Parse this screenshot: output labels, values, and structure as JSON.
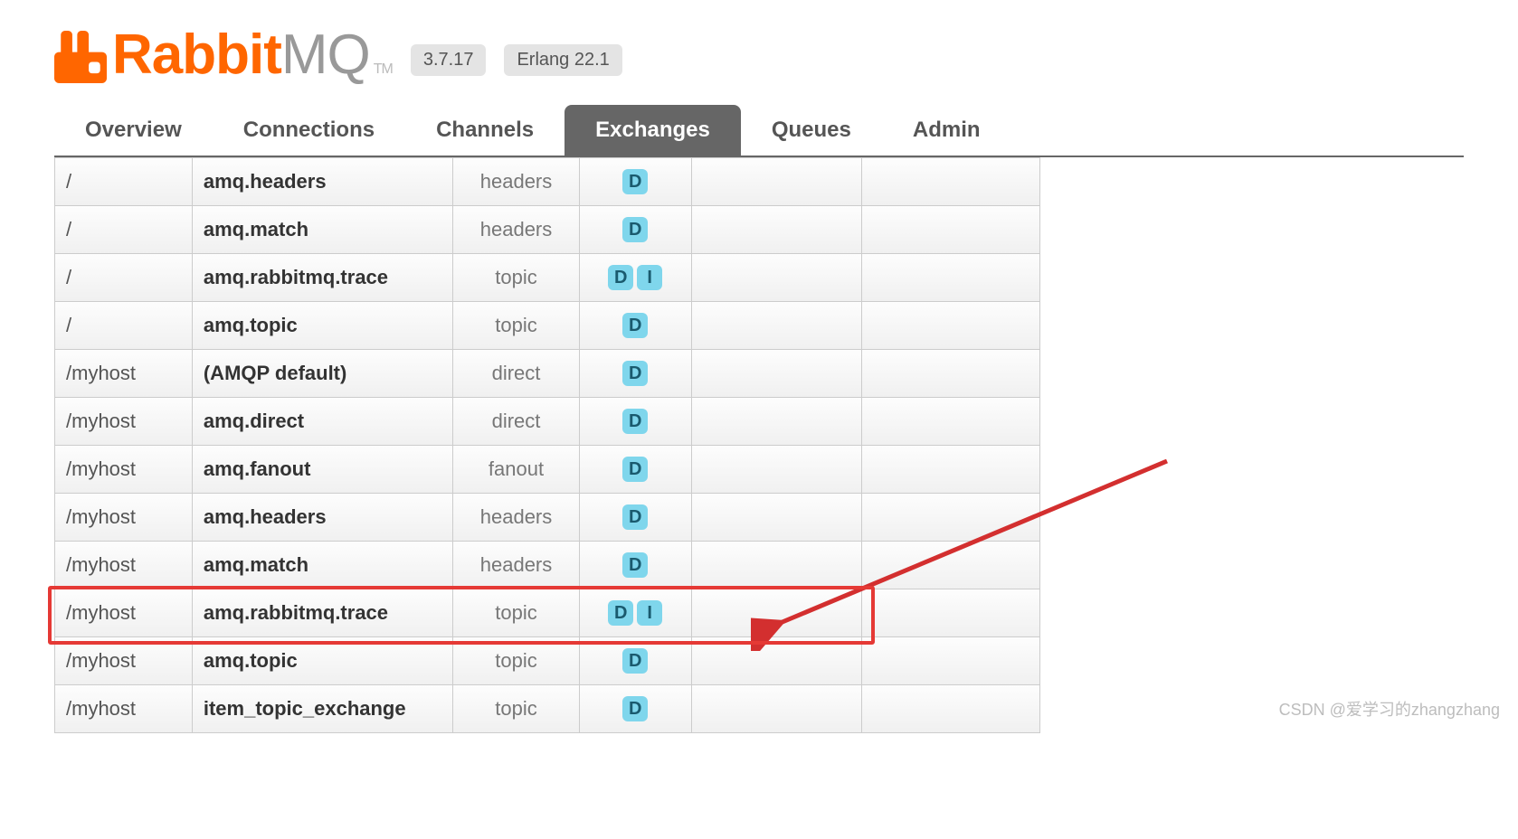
{
  "header": {
    "product_primary": "Rabbit",
    "product_secondary": "MQ",
    "trademark": "TM",
    "version_badge": "3.7.17",
    "erlang_badge": "Erlang 22.1"
  },
  "tabs": [
    {
      "id": "overview",
      "label": "Overview",
      "active": false
    },
    {
      "id": "connections",
      "label": "Connections",
      "active": false
    },
    {
      "id": "channels",
      "label": "Channels",
      "active": false
    },
    {
      "id": "exchanges",
      "label": "Exchanges",
      "active": true
    },
    {
      "id": "queues",
      "label": "Queues",
      "active": false
    },
    {
      "id": "admin",
      "label": "Admin",
      "active": false
    }
  ],
  "exchanges": [
    {
      "vhost": "/",
      "name": "amq.headers",
      "type": "headers",
      "flags": [
        "D"
      ]
    },
    {
      "vhost": "/",
      "name": "amq.match",
      "type": "headers",
      "flags": [
        "D"
      ]
    },
    {
      "vhost": "/",
      "name": "amq.rabbitmq.trace",
      "type": "topic",
      "flags": [
        "D",
        "I"
      ]
    },
    {
      "vhost": "/",
      "name": "amq.topic",
      "type": "topic",
      "flags": [
        "D"
      ]
    },
    {
      "vhost": "/myhost",
      "name": "(AMQP default)",
      "type": "direct",
      "flags": [
        "D"
      ]
    },
    {
      "vhost": "/myhost",
      "name": "amq.direct",
      "type": "direct",
      "flags": [
        "D"
      ]
    },
    {
      "vhost": "/myhost",
      "name": "amq.fanout",
      "type": "fanout",
      "flags": [
        "D"
      ]
    },
    {
      "vhost": "/myhost",
      "name": "amq.headers",
      "type": "headers",
      "flags": [
        "D"
      ]
    },
    {
      "vhost": "/myhost",
      "name": "amq.match",
      "type": "headers",
      "flags": [
        "D"
      ]
    },
    {
      "vhost": "/myhost",
      "name": "amq.rabbitmq.trace",
      "type": "topic",
      "flags": [
        "D",
        "I"
      ],
      "highlight": true
    },
    {
      "vhost": "/myhost",
      "name": "amq.topic",
      "type": "topic",
      "flags": [
        "D"
      ]
    },
    {
      "vhost": "/myhost",
      "name": "item_topic_exchange",
      "type": "topic",
      "flags": [
        "D"
      ]
    }
  ],
  "watermark": "CSDN @爱学习的zhangzhang"
}
